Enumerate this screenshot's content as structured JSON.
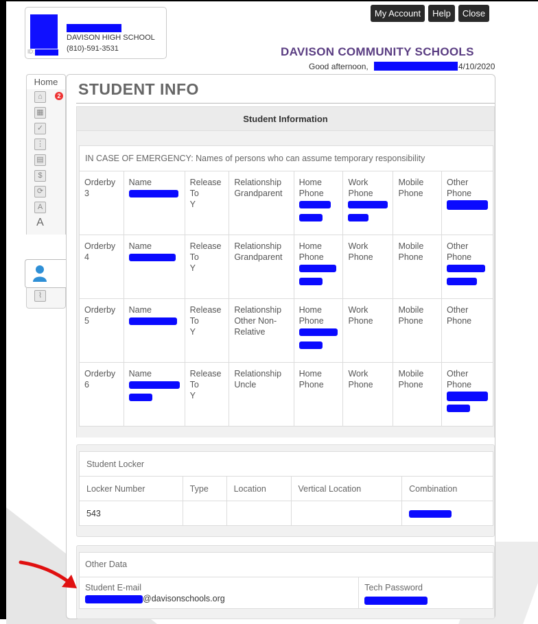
{
  "header": {
    "school": "DAVISON HIGH SCHOOL",
    "phone": "(810)-591-3531",
    "id_label": "ID:",
    "buttons": {
      "account": "My Account",
      "help": "Help",
      "close": "Close"
    },
    "district": "DAVISON COMMUNITY SCHOOLS",
    "greeting": "Good afternoon,",
    "date": "4/10/2020"
  },
  "nav": {
    "home": "Home",
    "badge_count": "2",
    "icons": [
      "home-notifications-icon",
      "calendar-icon",
      "checklist-icon",
      "schedule-grid-icon",
      "report-card-icon",
      "fees-icon",
      "payment-icon",
      "attendance-icon",
      "grades-icon",
      "student-info-icon",
      "progress-chart-icon"
    ]
  },
  "page": {
    "title": "STUDENT INFO",
    "section_header": "Student Information"
  },
  "emergency": {
    "caption": "IN CASE OF EMERGENCY: Names of persons who can assume temporary responsibility",
    "labels": {
      "orderby": "Orderby",
      "name": "Name",
      "release": "Release To",
      "relationship": "Relationship",
      "home": "Home Phone",
      "work": "Work Phone",
      "mobile": "Mobile Phone",
      "other": "Other Phone"
    },
    "rows": [
      {
        "order": "3",
        "release": "Y",
        "relationship": "Grandparent"
      },
      {
        "order": "4",
        "release": "Y",
        "relationship": "Grandparent"
      },
      {
        "order": "5",
        "release": "Y",
        "relationship": "Other Non-Relative"
      },
      {
        "order": "6",
        "release": "Y",
        "relationship": "Uncle"
      }
    ]
  },
  "locker": {
    "title": "Student Locker",
    "headers": [
      "Locker Number",
      "Type",
      "Location",
      "Vertical Location",
      "Combination"
    ],
    "values": [
      "543",
      "",
      "",
      "",
      ""
    ]
  },
  "other": {
    "title": "Other Data",
    "email_label": "Student E-mail",
    "email_suffix": "@davisonschools.org",
    "tech_label": "Tech Password"
  },
  "colors": {
    "redaction": "#0a0aff",
    "district": "#5a3d82",
    "arrow": "#e01010"
  }
}
